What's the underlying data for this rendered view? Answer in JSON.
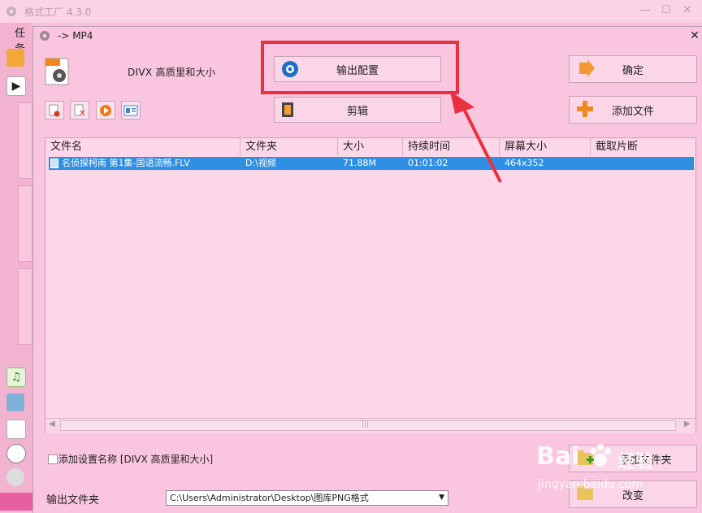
{
  "app": {
    "title": "格式工厂 4.3.0",
    "menu_label": "任务",
    "controls": {
      "minimize": "—",
      "maximize": "☐",
      "close": "✕"
    }
  },
  "dialog": {
    "title": "-> MP4",
    "close": "✕",
    "profile_label": "DIVX 高质里和大小",
    "buttons": {
      "output_config": "输出配置",
      "edit": "剪辑",
      "ok": "确定",
      "add_file": "添加文件",
      "add_folder": "添加文件夹",
      "change": "改变"
    },
    "file_list": {
      "columns": [
        "文件名",
        "文件夹",
        "大小",
        "持续时间",
        "屏幕大小",
        "截取片断"
      ],
      "rows": [
        {
          "name": "名侦探柯南 第1集-国语流畅.FLV",
          "folder": "D:\\视频",
          "size": "71.88M",
          "duration": "01:01:02",
          "screen": "464x352",
          "clip": ""
        }
      ]
    },
    "add_setting_label": "添加设置名称 [DIVX 高质里和大小]",
    "output_folder_label": "输出文件夹",
    "output_folder_value": "C:\\Users\\Administrator\\Desktop\\图库PNG格式",
    "scroll_grip": "|||"
  },
  "watermark": {
    "brand": "Bai",
    "brand2": "经验",
    "url": "jingyan.baidu.com"
  },
  "colors": {
    "annotation": "#ea2f3f",
    "selection": "#2f8fe3",
    "background": "#fac5df"
  }
}
